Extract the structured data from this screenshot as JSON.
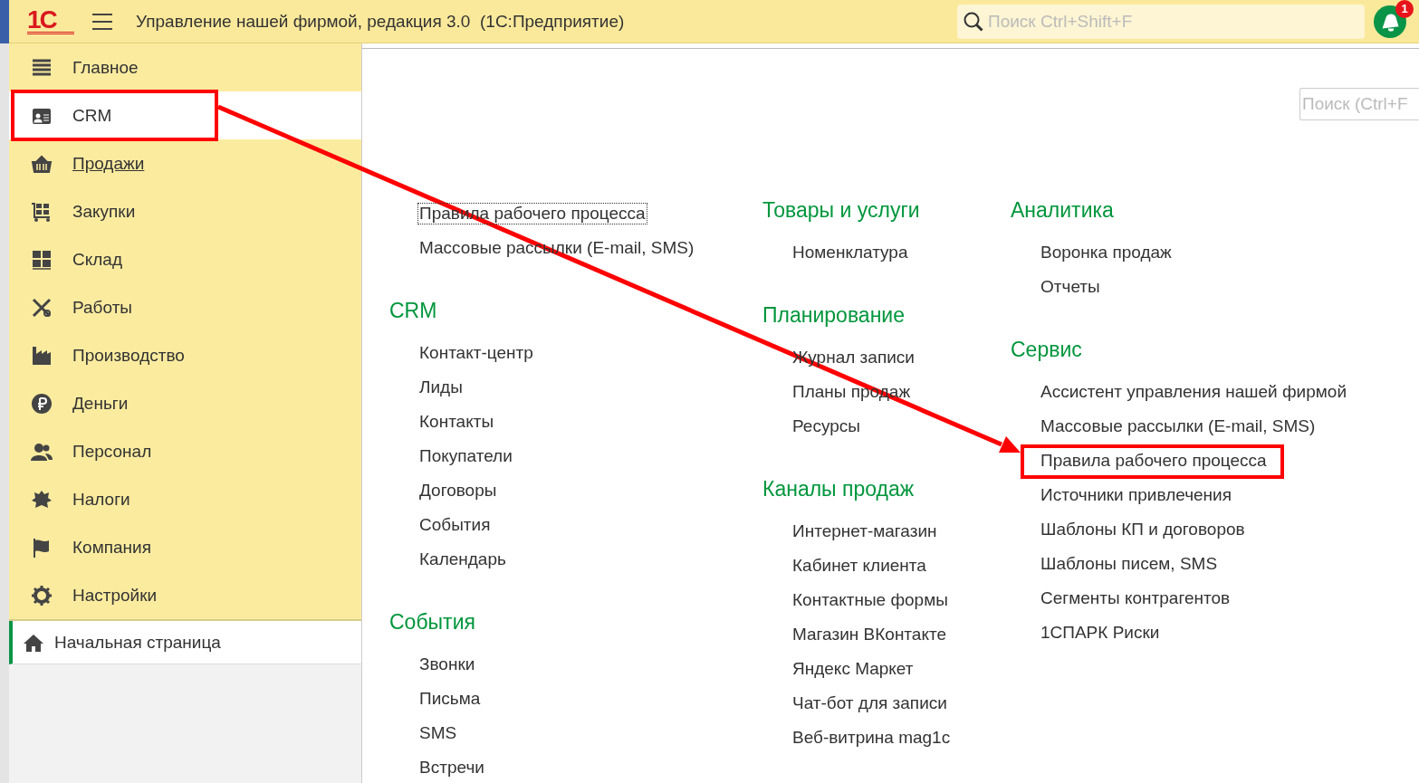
{
  "header": {
    "logo": "1С",
    "title": "Управление нашей фирмой, редакция 3.0  (1С:Предприятие)",
    "search": {
      "placeholder": "Поиск Ctrl+Shift+F"
    },
    "notifications": {
      "badge": "1"
    }
  },
  "sidebar": {
    "items": [
      {
        "label": "Главное",
        "selected": false,
        "hovered": false
      },
      {
        "label": "CRM",
        "selected": true,
        "hovered": false
      },
      {
        "label": "Продажи",
        "selected": false,
        "hovered": true
      },
      {
        "label": "Закупки",
        "selected": false,
        "hovered": false
      },
      {
        "label": "Склад",
        "selected": false,
        "hovered": false
      },
      {
        "label": "Работы",
        "selected": false,
        "hovered": false
      },
      {
        "label": "Производство",
        "selected": false,
        "hovered": false
      },
      {
        "label": "Деньги",
        "selected": false,
        "hovered": false
      },
      {
        "label": "Персонал",
        "selected": false,
        "hovered": false
      },
      {
        "label": "Налоги",
        "selected": false,
        "hovered": false
      },
      {
        "label": "Компания",
        "selected": false,
        "hovered": false
      },
      {
        "label": "Настройки",
        "selected": false,
        "hovered": false
      }
    ],
    "home": {
      "label": "Начальная страница",
      "selected": true
    }
  },
  "content": {
    "search": {
      "placeholder": "Поиск (Ctrl+F"
    },
    "columns": [
      {
        "groups": [
          {
            "items": [
              {
                "label": "Правила рабочего процесса",
                "focused": true
              },
              {
                "label": "Массовые рассылки (E-mail, SMS)",
                "focused": false
              }
            ]
          },
          {
            "title": "CRM",
            "items": [
              {
                "label": "Контакт-центр",
                "focused": false
              },
              {
                "label": "Лиды",
                "focused": false
              },
              {
                "label": "Контакты",
                "focused": false
              },
              {
                "label": "Покупатели",
                "focused": false
              },
              {
                "label": "Договоры",
                "focused": false
              },
              {
                "label": "События",
                "focused": false
              },
              {
                "label": "Календарь",
                "focused": false
              }
            ]
          },
          {
            "title": "События",
            "items": [
              {
                "label": "Звонки",
                "focused": false
              },
              {
                "label": "Письма",
                "focused": false
              },
              {
                "label": "SMS",
                "focused": false
              },
              {
                "label": "Встречи",
                "focused": false
              }
            ]
          }
        ]
      },
      {
        "groups": [
          {
            "title": "Товары и услуги",
            "items": [
              {
                "label": "Номенклатура",
                "focused": false
              }
            ]
          },
          {
            "title": "Планирование",
            "items": [
              {
                "label": "Журнал записи",
                "focused": false
              },
              {
                "label": "Планы продаж",
                "focused": false
              },
              {
                "label": "Ресурсы",
                "focused": false
              }
            ]
          },
          {
            "title": "Каналы продаж",
            "items": [
              {
                "label": "Интернет-магазин",
                "focused": false
              },
              {
                "label": "Кабинет клиента",
                "focused": false
              },
              {
                "label": "Контактные формы",
                "focused": false
              },
              {
                "label": "Магазин ВКонтакте",
                "focused": false
              },
              {
                "label": "Яндекс Маркет",
                "focused": false
              },
              {
                "label": "Чат-бот для записи",
                "focused": false
              },
              {
                "label": "Веб-витрина mag1c",
                "focused": false
              }
            ]
          }
        ]
      },
      {
        "groups": [
          {
            "title": "Аналитика",
            "items": [
              {
                "label": "Воронка продаж",
                "focused": false
              },
              {
                "label": "Отчеты",
                "focused": false
              }
            ]
          },
          {
            "title": "Сервис",
            "items": [
              {
                "label": "Ассистент управления нашей фирмой",
                "focused": false
              },
              {
                "label": "Массовые рассылки (E-mail, SMS)",
                "focused": false
              },
              {
                "label": "Правила рабочего процесса",
                "focused": false
              },
              {
                "label": "Источники привлечения",
                "focused": false
              },
              {
                "label": "Шаблоны КП и договоров",
                "focused": false
              },
              {
                "label": "Шаблоны писем, SMS",
                "focused": false
              },
              {
                "label": "Сегменты контрагентов",
                "focused": false
              },
              {
                "label": "1СПАРК Риски",
                "focused": false
              }
            ]
          }
        ]
      }
    ]
  }
}
